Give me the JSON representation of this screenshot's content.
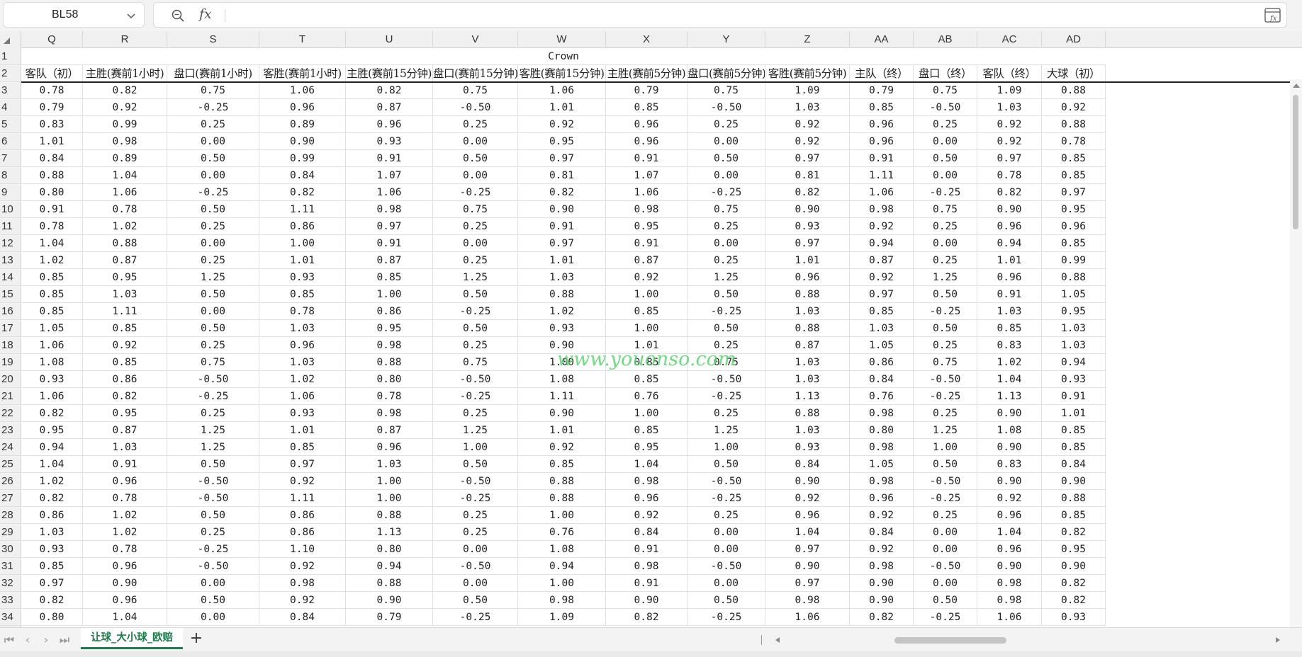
{
  "formula_bar": {
    "name_box": "BL58",
    "fx_label": "fx",
    "formula_value": ""
  },
  "columns": [
    "Q",
    "R",
    "S",
    "T",
    "U",
    "V",
    "W",
    "X",
    "Y",
    "Z",
    "AA",
    "AB",
    "AC",
    "AD"
  ],
  "row_numbers": [
    "1",
    "2",
    "3",
    "4",
    "5",
    "6",
    "7",
    "8",
    "9",
    "10",
    "11",
    "12",
    "13",
    "14",
    "15",
    "16",
    "17",
    "18",
    "19",
    "20",
    "21",
    "22",
    "23",
    "24",
    "25",
    "26",
    "27",
    "28",
    "29",
    "30",
    "31",
    "32",
    "33",
    "34"
  ],
  "group_header": "Crown",
  "headers": [
    "客队（初）",
    "主胜(赛前1小时)",
    "盘口(赛前1小时)",
    "客胜(赛前1小时)",
    "主胜(赛前15分钟)",
    "盘口(赛前15分钟)",
    "客胜(赛前15分钟)",
    "主胜(赛前5分钟)",
    "盘口(赛前5分钟)",
    "客胜(赛前5分钟)",
    "主队（终）",
    "盘口（终）",
    "客队（终）",
    "大球（初）"
  ],
  "rows": [
    [
      "0.78",
      "0.82",
      "0.75",
      "1.06",
      "0.82",
      "0.75",
      "1.06",
      "0.79",
      "0.75",
      "1.09",
      "0.79",
      "0.75",
      "1.09",
      "0.88"
    ],
    [
      "0.79",
      "0.92",
      "-0.25",
      "0.96",
      "0.87",
      "-0.50",
      "1.01",
      "0.85",
      "-0.50",
      "1.03",
      "0.85",
      "-0.50",
      "1.03",
      "0.92"
    ],
    [
      "0.83",
      "0.99",
      "0.25",
      "0.89",
      "0.96",
      "0.25",
      "0.92",
      "0.96",
      "0.25",
      "0.92",
      "0.96",
      "0.25",
      "0.92",
      "0.88"
    ],
    [
      "1.01",
      "0.98",
      "0.00",
      "0.90",
      "0.93",
      "0.00",
      "0.95",
      "0.96",
      "0.00",
      "0.92",
      "0.96",
      "0.00",
      "0.92",
      "0.78"
    ],
    [
      "0.84",
      "0.89",
      "0.50",
      "0.99",
      "0.91",
      "0.50",
      "0.97",
      "0.91",
      "0.50",
      "0.97",
      "0.91",
      "0.50",
      "0.97",
      "0.85"
    ],
    [
      "0.88",
      "1.04",
      "0.00",
      "0.84",
      "1.07",
      "0.00",
      "0.81",
      "1.07",
      "0.00",
      "0.81",
      "1.11",
      "0.00",
      "0.78",
      "0.85"
    ],
    [
      "0.80",
      "1.06",
      "-0.25",
      "0.82",
      "1.06",
      "-0.25",
      "0.82",
      "1.06",
      "-0.25",
      "0.82",
      "1.06",
      "-0.25",
      "0.82",
      "0.97"
    ],
    [
      "0.91",
      "0.78",
      "0.50",
      "1.11",
      "0.98",
      "0.75",
      "0.90",
      "0.98",
      "0.75",
      "0.90",
      "0.98",
      "0.75",
      "0.90",
      "0.95"
    ],
    [
      "0.78",
      "1.02",
      "0.25",
      "0.86",
      "0.97",
      "0.25",
      "0.91",
      "0.95",
      "0.25",
      "0.93",
      "0.92",
      "0.25",
      "0.96",
      "0.96"
    ],
    [
      "1.04",
      "0.88",
      "0.00",
      "1.00",
      "0.91",
      "0.00",
      "0.97",
      "0.91",
      "0.00",
      "0.97",
      "0.94",
      "0.00",
      "0.94",
      "0.85"
    ],
    [
      "1.02",
      "0.87",
      "0.25",
      "1.01",
      "0.87",
      "0.25",
      "1.01",
      "0.87",
      "0.25",
      "1.01",
      "0.87",
      "0.25",
      "1.01",
      "0.99"
    ],
    [
      "0.85",
      "0.95",
      "1.25",
      "0.93",
      "0.85",
      "1.25",
      "1.03",
      "0.92",
      "1.25",
      "0.96",
      "0.92",
      "1.25",
      "0.96",
      "0.88"
    ],
    [
      "0.85",
      "1.03",
      "0.50",
      "0.85",
      "1.00",
      "0.50",
      "0.88",
      "1.00",
      "0.50",
      "0.88",
      "0.97",
      "0.50",
      "0.91",
      "1.05"
    ],
    [
      "0.85",
      "1.11",
      "0.00",
      "0.78",
      "0.86",
      "-0.25",
      "1.02",
      "0.85",
      "-0.25",
      "1.03",
      "0.85",
      "-0.25",
      "1.03",
      "0.95"
    ],
    [
      "1.05",
      "0.85",
      "0.50",
      "1.03",
      "0.95",
      "0.50",
      "0.93",
      "1.00",
      "0.50",
      "0.88",
      "1.03",
      "0.50",
      "0.85",
      "1.03"
    ],
    [
      "1.06",
      "0.92",
      "0.25",
      "0.96",
      "0.98",
      "0.25",
      "0.90",
      "1.01",
      "0.25",
      "0.87",
      "1.05",
      "0.25",
      "0.83",
      "1.03"
    ],
    [
      "1.08",
      "0.85",
      "0.75",
      "1.03",
      "0.88",
      "0.75",
      "1.00",
      "0.85",
      "0.75",
      "1.03",
      "0.86",
      "0.75",
      "1.02",
      "0.94"
    ],
    [
      "0.93",
      "0.86",
      "-0.50",
      "1.02",
      "0.80",
      "-0.50",
      "1.08",
      "0.85",
      "-0.50",
      "1.03",
      "0.84",
      "-0.50",
      "1.04",
      "0.93"
    ],
    [
      "1.06",
      "0.82",
      "-0.25",
      "1.06",
      "0.78",
      "-0.25",
      "1.11",
      "0.76",
      "-0.25",
      "1.13",
      "0.76",
      "-0.25",
      "1.13",
      "0.91"
    ],
    [
      "0.82",
      "0.95",
      "0.25",
      "0.93",
      "0.98",
      "0.25",
      "0.90",
      "1.00",
      "0.25",
      "0.88",
      "0.98",
      "0.25",
      "0.90",
      "1.01"
    ],
    [
      "0.95",
      "0.87",
      "1.25",
      "1.01",
      "0.87",
      "1.25",
      "1.01",
      "0.85",
      "1.25",
      "1.03",
      "0.80",
      "1.25",
      "1.08",
      "0.85"
    ],
    [
      "0.94",
      "1.03",
      "1.25",
      "0.85",
      "0.96",
      "1.00",
      "0.92",
      "0.95",
      "1.00",
      "0.93",
      "0.98",
      "1.00",
      "0.90",
      "0.85"
    ],
    [
      "1.04",
      "0.91",
      "0.50",
      "0.97",
      "1.03",
      "0.50",
      "0.85",
      "1.04",
      "0.50",
      "0.84",
      "1.05",
      "0.50",
      "0.83",
      "0.84"
    ],
    [
      "1.02",
      "0.96",
      "-0.50",
      "0.92",
      "1.00",
      "-0.50",
      "0.88",
      "0.98",
      "-0.50",
      "0.90",
      "0.98",
      "-0.50",
      "0.90",
      "0.90"
    ],
    [
      "0.82",
      "0.78",
      "-0.50",
      "1.11",
      "1.00",
      "-0.25",
      "0.88",
      "0.96",
      "-0.25",
      "0.92",
      "0.96",
      "-0.25",
      "0.92",
      "0.88"
    ],
    [
      "0.86",
      "1.02",
      "0.50",
      "0.86",
      "0.88",
      "0.25",
      "1.00",
      "0.92",
      "0.25",
      "0.96",
      "0.92",
      "0.25",
      "0.96",
      "0.85"
    ],
    [
      "1.03",
      "1.02",
      "0.25",
      "0.86",
      "1.13",
      "0.25",
      "0.76",
      "0.84",
      "0.00",
      "1.04",
      "0.84",
      "0.00",
      "1.04",
      "0.82"
    ],
    [
      "0.93",
      "0.78",
      "-0.25",
      "1.10",
      "0.80",
      "0.00",
      "1.08",
      "0.91",
      "0.00",
      "0.97",
      "0.92",
      "0.00",
      "0.96",
      "0.95"
    ],
    [
      "0.85",
      "0.96",
      "-0.50",
      "0.92",
      "0.94",
      "-0.50",
      "0.94",
      "0.98",
      "-0.50",
      "0.90",
      "0.98",
      "-0.50",
      "0.90",
      "0.90"
    ],
    [
      "0.97",
      "0.90",
      "0.00",
      "0.98",
      "0.88",
      "0.00",
      "1.00",
      "0.91",
      "0.00",
      "0.97",
      "0.90",
      "0.00",
      "0.98",
      "0.82"
    ],
    [
      "0.82",
      "0.96",
      "0.50",
      "0.92",
      "0.90",
      "0.50",
      "0.98",
      "0.90",
      "0.50",
      "0.98",
      "0.90",
      "0.50",
      "0.98",
      "0.82"
    ],
    [
      "0.80",
      "1.04",
      "0.00",
      "0.84",
      "0.79",
      "-0.25",
      "1.09",
      "0.82",
      "-0.25",
      "1.06",
      "0.82",
      "-0.25",
      "1.06",
      "0.93"
    ]
  ],
  "watermark": "www.youonso.com",
  "sheet_tabs": [
    {
      "label": "让球_大小球_欧赔",
      "active": true
    }
  ],
  "tab_nav": {
    "first": "⏮",
    "prev": "‹",
    "next": "›",
    "last": "⏭"
  },
  "add_sheet_label": "+",
  "colors": {
    "accent": "#1f7a4d",
    "watermark": "#5ad26e"
  }
}
